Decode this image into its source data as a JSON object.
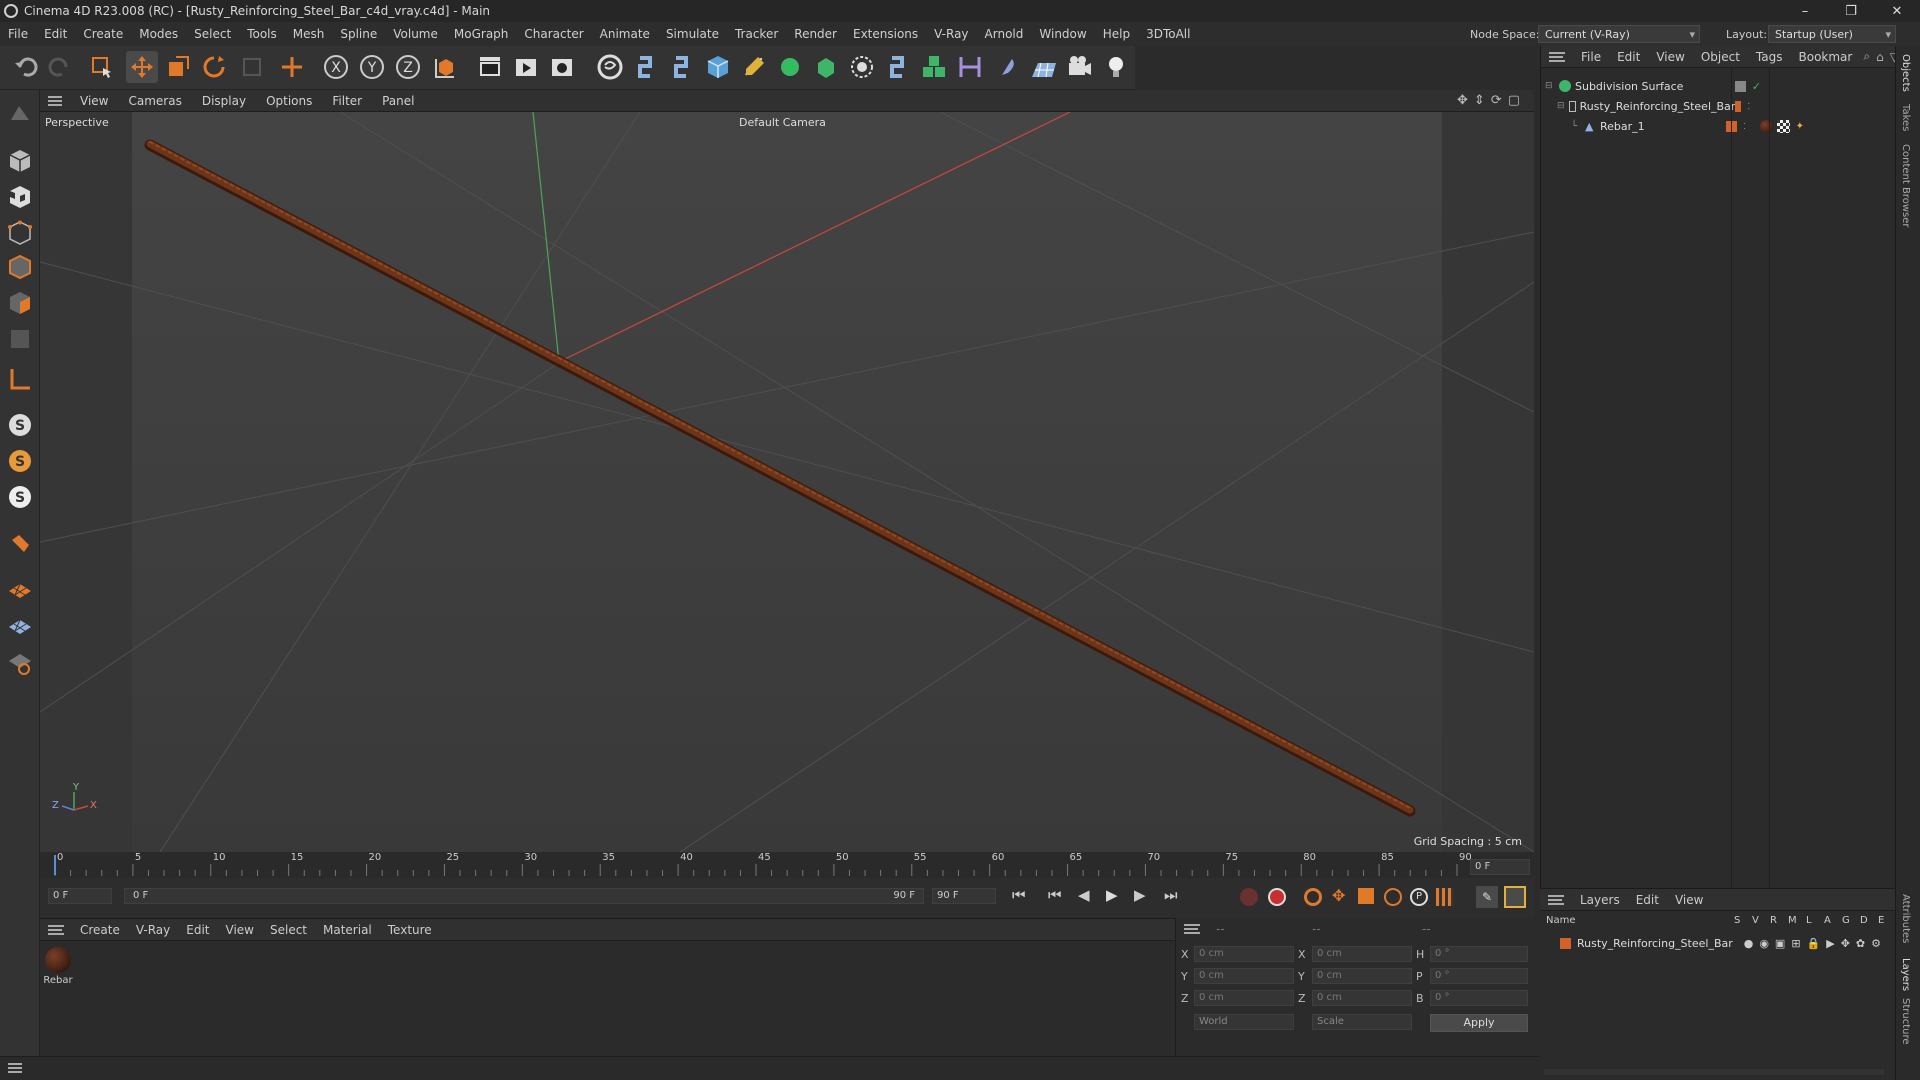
{
  "window": {
    "title": "Cinema 4D R23.008 (RC) - [Rusty_Reinforcing_Steel_Bar_c4d_vray.c4d] - Main",
    "minimize": "–",
    "restore": "❐",
    "close": "✕"
  },
  "menu": {
    "items": [
      "File",
      "Edit",
      "Create",
      "Modes",
      "Select",
      "Tools",
      "Mesh",
      "Spline",
      "Volume",
      "MoGraph",
      "Character",
      "Animate",
      "Simulate",
      "Tracker",
      "Render",
      "Extensions",
      "V-Ray",
      "Arnold",
      "Window",
      "Help",
      "3DToAll"
    ]
  },
  "header": {
    "node_space_label": "Node Space:",
    "node_space_value": "Current (V-Ray)",
    "layout_label": "Layout:",
    "layout_value": "Startup (User)"
  },
  "viewport": {
    "menu": [
      "View",
      "Cameras",
      "Display",
      "Options",
      "Filter",
      "Panel"
    ],
    "view_name": "Perspective",
    "camera": "Default Camera",
    "grid_spacing": "Grid Spacing : 5 cm",
    "axis_labels": {
      "x": "X",
      "y": "Y",
      "z": "Z"
    }
  },
  "timeline": {
    "ticks": [
      "0",
      "5",
      "10",
      "15",
      "20",
      "25",
      "30",
      "35",
      "40",
      "45",
      "50",
      "55",
      "60",
      "65",
      "70",
      "75",
      "80",
      "85",
      "90"
    ],
    "current_frame": "0 F"
  },
  "transport": {
    "start_field": "0 F",
    "slider_left": "0 F",
    "slider_right": "90 F",
    "end_field": "90 F"
  },
  "materials": {
    "menu": [
      "Create",
      "V-Ray",
      "Edit",
      "View",
      "Select",
      "Material",
      "Texture"
    ],
    "items": [
      {
        "label": "Rebar",
        "color": "#3a1c10"
      }
    ]
  },
  "coords": {
    "header": [
      "--",
      "--",
      "--"
    ],
    "rows": [
      {
        "a": "X",
        "av": "0 cm",
        "b": "X",
        "bv": "0 cm",
        "c": "H",
        "cv": "0 °"
      },
      {
        "a": "Y",
        "av": "0 cm",
        "b": "Y",
        "bv": "0 cm",
        "c": "P",
        "cv": "0 °"
      },
      {
        "a": "Z",
        "av": "0 cm",
        "b": "Z",
        "bv": "0 cm",
        "c": "B",
        "cv": "0 °"
      }
    ],
    "space": "World",
    "mode": "Scale",
    "apply": "Apply"
  },
  "objects": {
    "menu": [
      "File",
      "Edit",
      "View",
      "Object",
      "Tags",
      "Bookmar"
    ],
    "tree": [
      {
        "name": "Subdivision Surface",
        "indent": 0
      },
      {
        "name": "Rusty_Reinforcing_Steel_Bar",
        "indent": 1
      },
      {
        "name": "Rebar_1",
        "indent": 2
      }
    ]
  },
  "layers": {
    "menu": [
      "Layers",
      "Edit",
      "View"
    ],
    "columns": [
      "Name",
      "S",
      "V",
      "R",
      "M",
      "L",
      "A",
      "G",
      "D",
      "E"
    ],
    "rows": [
      {
        "name": "Rusty_Reinforcing_Steel_Bar",
        "color": "#d0622a"
      }
    ]
  },
  "side_tabs": [
    "Objects",
    "Takes",
    "Content Browser",
    "Attributes",
    "Layers",
    "Structure"
  ],
  "colors": {
    "accent_orange": "#d0622a",
    "axis_x": "#c8473f",
    "axis_y": "#4fa35a",
    "rebar": "#5a2c16"
  }
}
